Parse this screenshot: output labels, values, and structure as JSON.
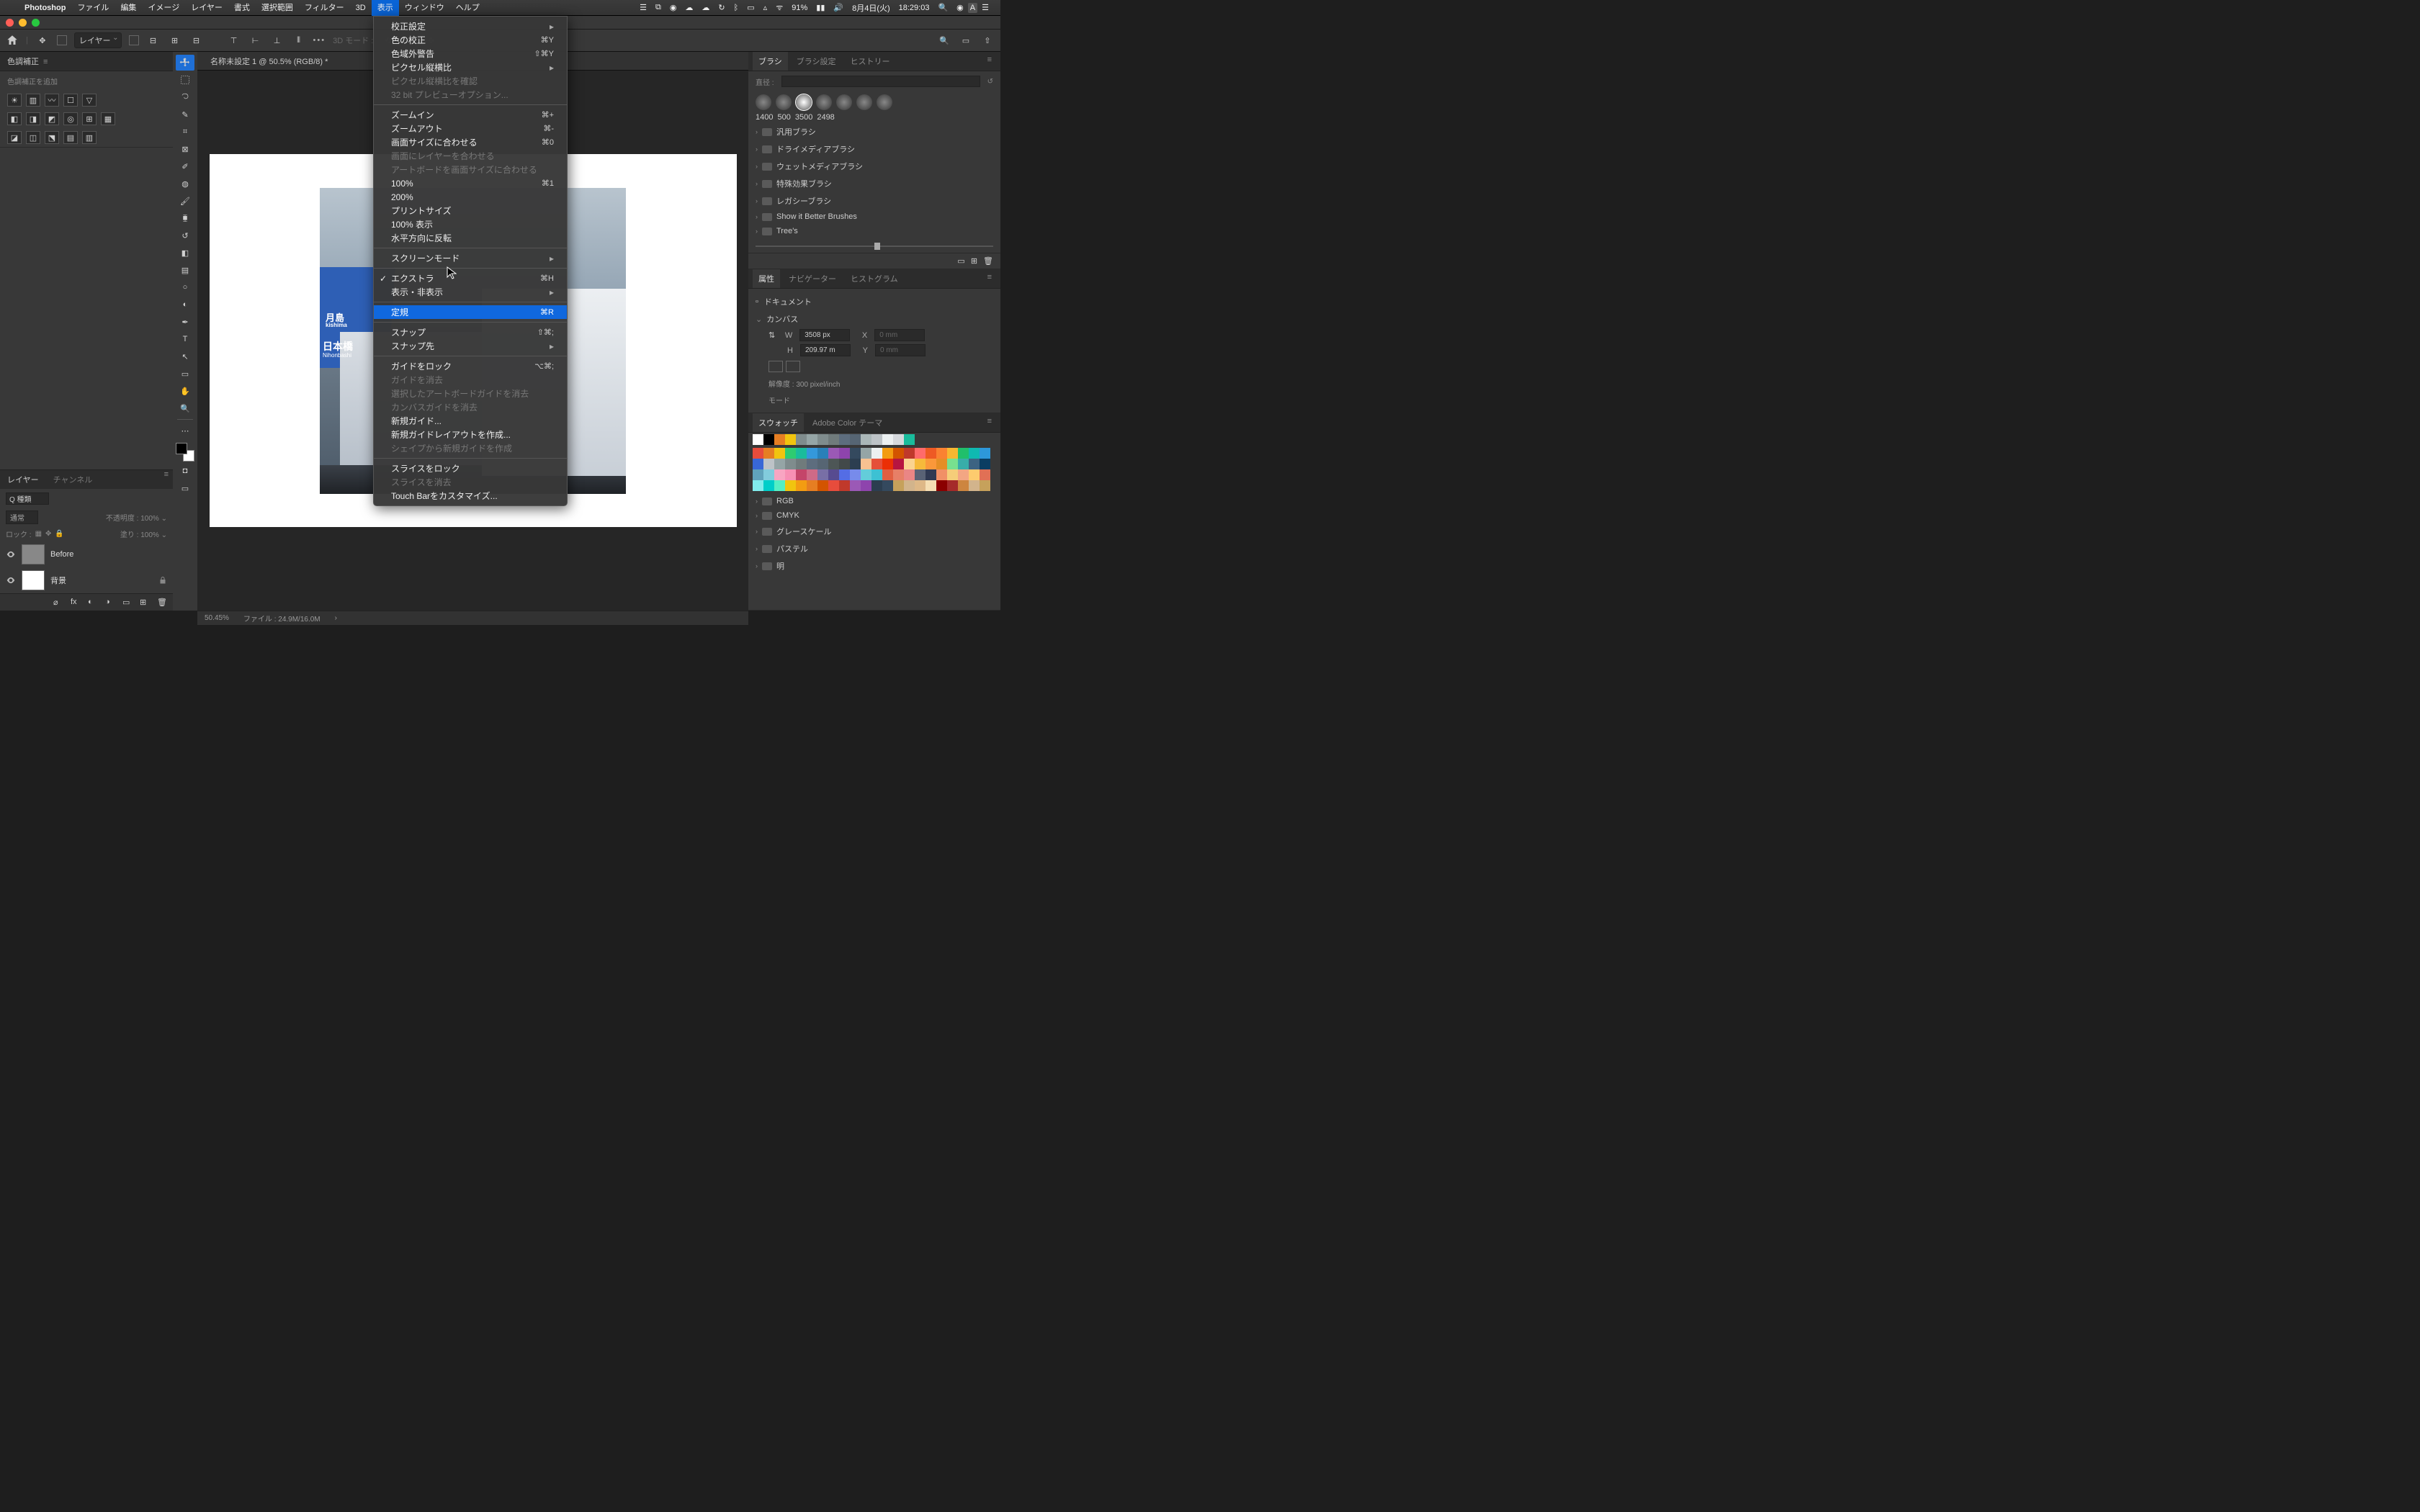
{
  "menubar": {
    "app": "Photoshop",
    "items": [
      "ファイル",
      "編集",
      "イメージ",
      "レイヤー",
      "書式",
      "選択範囲",
      "フィルター",
      "3D",
      "表示",
      "ウィンドウ",
      "ヘルプ"
    ],
    "active_index": 8,
    "battery": "91%",
    "date": "8月4日(火)",
    "time": "18:29:03"
  },
  "optbar": {
    "layer_label": "レイヤー",
    "mode_3d": "3D モード :"
  },
  "doctab": "名称未設定 1 @ 50.5% (RGB/8) *",
  "dropdown": {
    "groups": [
      [
        {
          "label": "校正設定",
          "sub": true
        },
        {
          "label": "色の校正",
          "sc": "⌘Y"
        },
        {
          "label": "色域外警告",
          "sc": "⇧⌘Y"
        },
        {
          "label": "ピクセル縦横比",
          "sub": true
        },
        {
          "label": "ピクセル縦横比を確認",
          "dis": true
        },
        {
          "label": "32 bit プレビューオプション...",
          "dis": true
        }
      ],
      [
        {
          "label": "ズームイン",
          "sc": "⌘+"
        },
        {
          "label": "ズームアウト",
          "sc": "⌘-"
        },
        {
          "label": "画面サイズに合わせる",
          "sc": "⌘0"
        },
        {
          "label": "画面にレイヤーを合わせる",
          "dis": true
        },
        {
          "label": "アートボードを画面サイズに合わせる",
          "dis": true
        },
        {
          "label": "100%",
          "sc": "⌘1"
        },
        {
          "label": "200%"
        },
        {
          "label": "プリントサイズ"
        },
        {
          "label": "100% 表示"
        },
        {
          "label": "水平方向に反転"
        }
      ],
      [
        {
          "label": "スクリーンモード",
          "sub": true
        }
      ],
      [
        {
          "label": "エクストラ",
          "sc": "⌘H",
          "chk": true
        },
        {
          "label": "表示・非表示",
          "sub": true
        }
      ],
      [
        {
          "label": "定規",
          "sc": "⌘R",
          "hl": true
        }
      ],
      [
        {
          "label": "スナップ",
          "sc": "⇧⌘;"
        },
        {
          "label": "スナップ先",
          "sub": true
        }
      ],
      [
        {
          "label": "ガイドをロック",
          "sc": "⌥⌘;"
        },
        {
          "label": "ガイドを消去",
          "dis": true
        },
        {
          "label": "選択したアートボードガイドを消去",
          "dis": true
        },
        {
          "label": "カンバスガイドを消去",
          "dis": true
        },
        {
          "label": "新規ガイド..."
        },
        {
          "label": "新規ガイドレイアウトを作成..."
        },
        {
          "label": "シェイプから新規ガイドを作成",
          "dis": true
        }
      ],
      [
        {
          "label": "スライスをロック"
        },
        {
          "label": "スライスを消去",
          "dis": true
        },
        {
          "label": "Touch Barをカスタマイズ..."
        }
      ]
    ]
  },
  "left": {
    "adj_title": "色調補正",
    "adj_sub": "色調補正を追加",
    "layers_tab": "レイヤー",
    "channels_tab": "チャンネル",
    "kind_label": "Q 種類",
    "blend": "通常",
    "opacity_lbl": "不透明度 :",
    "opacity_val": "100%",
    "lock_lbl": "ロック :",
    "fill_lbl": "塗り :",
    "fill_val": "100%",
    "layer1": "Before",
    "layer2": "背景"
  },
  "right": {
    "brush_tab": "ブラシ",
    "brush_set_tab": "ブラシ設定",
    "history_tab": "ヒストリー",
    "diameter": "直径 :",
    "preset_labels": [
      "1400",
      "500",
      "3500",
      "2498"
    ],
    "folders": [
      "汎用ブラシ",
      "ドライメディアブラシ",
      "ウェットメディアブラシ",
      "特殊効果ブラシ",
      "レガシーブラシ",
      "Show it Better Brushes",
      "Tree's"
    ],
    "prop_tab": "属性",
    "nav_tab": "ナビゲーター",
    "hist_tab": "ヒストグラム",
    "doc_label": "ドキュメント",
    "canvas_label": "カンバス",
    "w_lbl": "W",
    "w_val": "3508 px",
    "x_lbl": "X",
    "x_val": "0 mm",
    "h_lbl": "H",
    "h_val": "209.97 m",
    "y_lbl": "Y",
    "y_val": "0 mm",
    "res": "解像度 : 300 pixel/inch",
    "mode": "モード",
    "swatch_tab": "スウォッチ",
    "color_tab": "Adobe Color テーマ",
    "color_folders": [
      "RGB",
      "CMYK",
      "グレースケール",
      "パステル",
      "明"
    ]
  },
  "status": {
    "zoom": "50.45%",
    "file": "ファイル : 24.9M/16.0M"
  },
  "photo": {
    "sign1": "月島",
    "sign1b": "kishima",
    "sign2": "日本橋",
    "sign3": "Nihonbashi"
  },
  "swatches_row1": [
    "#ffffff",
    "#000000",
    "#e67e22",
    "#f1c40f",
    "#7f8c8d",
    "#95a5a6",
    "#7f8c8d",
    "#707b7c",
    "#5d6d7e",
    "#566573",
    "#aab7b8",
    "#bdc3c7",
    "#ecf0f1",
    "#d5d8dc",
    "#1abc9c"
  ],
  "swatches_rows": [
    [
      "#e74c3c",
      "#e67e22",
      "#f1c40f",
      "#2ecc71",
      "#1abc9c",
      "#3498db",
      "#2980b9",
      "#9b59b6",
      "#8e44ad",
      "#34495e",
      "#95a5a6",
      "#ecf0f1",
      "#f39c12",
      "#d35400",
      "#c0392b",
      "#ff6b6b",
      "#ee5a24",
      "#fa8231",
      "#f7b731",
      "#20bf6b",
      "#0fb9b1",
      "#2d98da",
      "#3867d6"
    ],
    [
      "#bdc3c7",
      "#95a5a6",
      "#7f8c8d",
      "#707b7c",
      "#5d6d7e",
      "#566573",
      "#4d5656",
      "#424949",
      "#2c3e50",
      "#f8c291",
      "#e55039",
      "#eb2f06",
      "#b71540",
      "#fad390",
      "#f6b93b",
      "#fa983a",
      "#e58e26",
      "#78e08f",
      "#38ada9",
      "#3c6382",
      "#0a3d62",
      "#60a3bc",
      "#82ccdd"
    ],
    [
      "#f8a5c2",
      "#f78fb3",
      "#c44569",
      "#cf6a87",
      "#786fa6",
      "#574b90",
      "#546de5",
      "#778beb",
      "#63cdda",
      "#3dc1d3",
      "#e15f41",
      "#e77f67",
      "#ea8685",
      "#596275",
      "#303952",
      "#f19066",
      "#f5cd79",
      "#f3a683",
      "#fdcb6e",
      "#e17055",
      "#81ecec",
      "#00cec9",
      "#55efc4"
    ],
    [
      "#f1c40f",
      "#f39c12",
      "#e67e22",
      "#d35400",
      "#e74c3c",
      "#c0392b",
      "#9b59b6",
      "#8e44ad",
      "#2c3e50",
      "#34495e",
      "#c6a15b",
      "#d2b48c",
      "#deb887",
      "#f5deb3"
    ],
    [
      "#8b0000",
      "#a52a2a",
      "#cd853f",
      "#d2b48c",
      "#c6a15b"
    ]
  ]
}
